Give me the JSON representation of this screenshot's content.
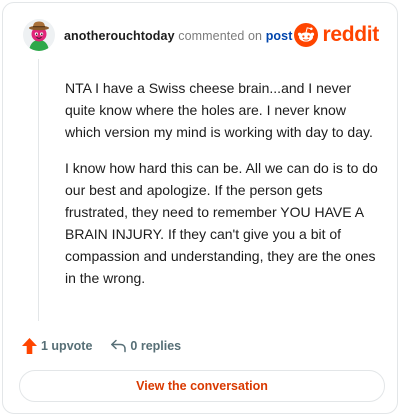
{
  "header": {
    "username": "anotherouchtoday",
    "action_text": "commented on",
    "post_link": "post",
    "brand": "reddit"
  },
  "comment": {
    "paragraphs": [
      "NTA I have a Swiss cheese brain...and I never quite know where the holes are. I never know which version my mind is working with day to day.",
      "I know how hard this can be. All we can do is to do our best and apologize. If the person gets frustrated, they need to remember YOU HAVE A BRAIN INJURY. If they can't give you a bit of compassion and understanding, they are the ones in the wrong."
    ]
  },
  "actions": {
    "upvotes": "1 upvote",
    "replies": "0 replies"
  },
  "cta": {
    "label": "View the conversation"
  },
  "colors": {
    "accent": "#ff4500",
    "link": "#0045ac",
    "cta_text": "#d93900",
    "muted": "#576f76"
  },
  "icons": {
    "upvote": "upvote-arrow-icon",
    "reply": "reply-arrow-icon",
    "brand": "reddit-snoo-icon"
  }
}
